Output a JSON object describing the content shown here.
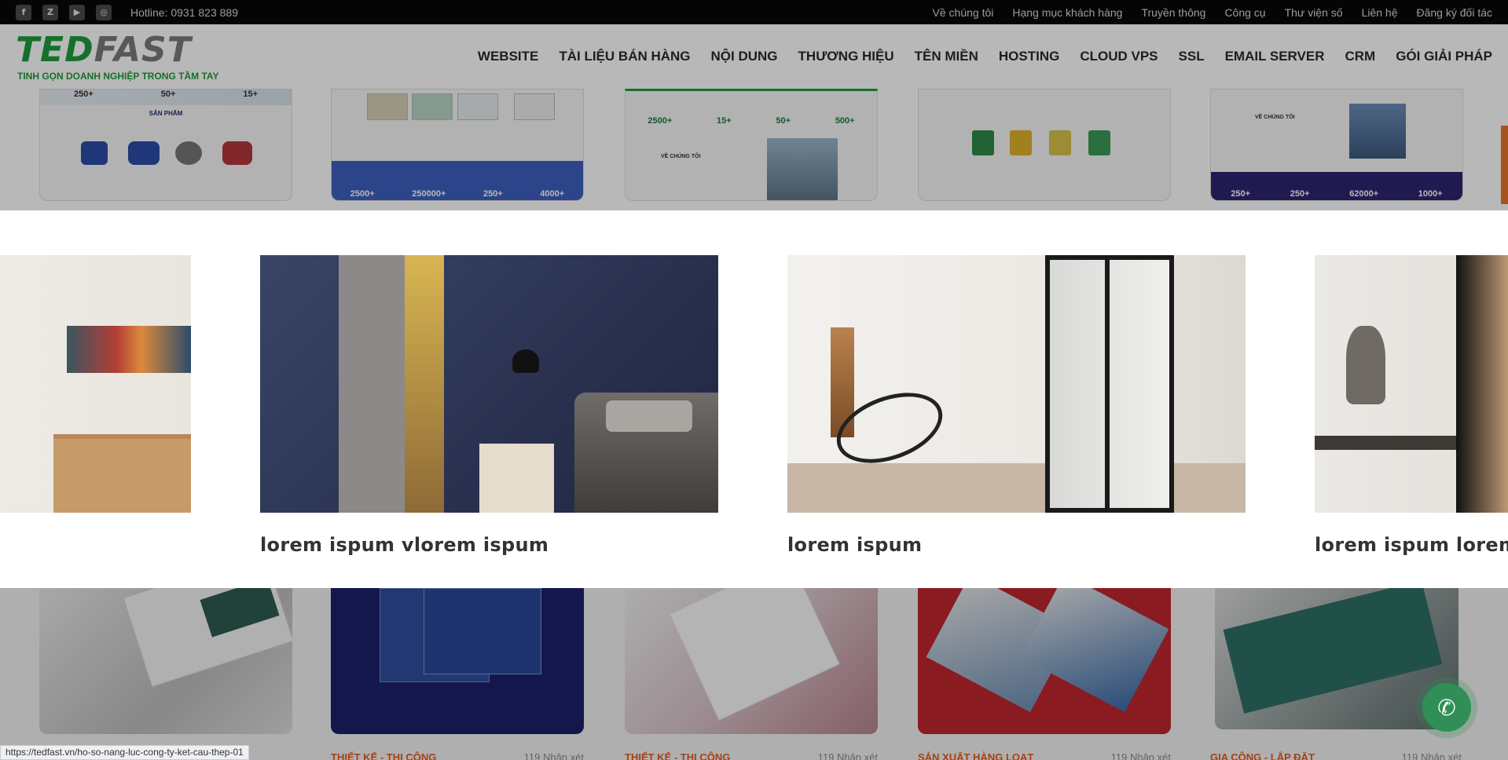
{
  "topbar": {
    "social_icons": [
      "facebook-icon",
      "zalo-icon",
      "youtube-icon",
      "instagram-icon"
    ],
    "social_glyphs": [
      "f",
      "Z",
      "▶",
      "◎"
    ],
    "hotline": "Hotline: 0931 823 889",
    "links": [
      "Về chúng tôi",
      "Hạng mục khách hàng",
      "Truyền thông",
      "Công cụ",
      "Thư viện số",
      "Liên hệ",
      "Đăng ký đối tác"
    ]
  },
  "header": {
    "logo_text_main": "TED",
    "logo_text_second": "FAST",
    "logo_slogan": "TINH GỌN DOANH NGHIỆP TRONG TẦM TAY",
    "nav": [
      "WEBSITE",
      "TÀI LIỆU BÁN HÀNG",
      "NỘI DUNG",
      "THƯƠNG HIỆU",
      "TÊN MIỀN",
      "HOSTING",
      "CLOUD VPS",
      "SSL",
      "EMAIL SERVER",
      "CRM",
      "GÓI GIẢI PHÁP"
    ]
  },
  "bg_cards": [
    {
      "stats": [
        "250+",
        "50+",
        "15+"
      ],
      "heading": "SẢN PHẨM"
    },
    {
      "stats": [
        "2500+",
        "250000+",
        "250+",
        "4000+"
      ]
    },
    {
      "stats": [
        "2500+",
        "15+",
        "50+",
        "500+"
      ],
      "heading": "VỀ CHÚNG TÔI"
    },
    {
      "stats": []
    },
    {
      "stats": [
        "250+",
        "250+",
        "62000+",
        "1000+"
      ],
      "heading": "VỀ CHÚNG TÔI"
    }
  ],
  "slider": {
    "slides": [
      {
        "caption": ""
      },
      {
        "caption": "lorem ispum vlorem ispum"
      },
      {
        "caption": "lorem ispum"
      },
      {
        "caption": "lorem ispum lorem i"
      }
    ]
  },
  "bottom_cards": [
    {
      "category": "",
      "comments": ""
    },
    {
      "category": "THIẾT KẾ - THI CÔNG",
      "comments": "119 Nhận xét"
    },
    {
      "category": "THIẾT KẾ - THI CÔNG",
      "comments": "119 Nhận xét"
    },
    {
      "category": "SẢN XUẤT HÀNG LOẠT",
      "comments": "119 Nhận xét"
    },
    {
      "category": "GIA CÔNG - LẮP ĐẶT",
      "comments": "119 Nhận xét"
    }
  ],
  "status_url": "https://tedfast.vn/ho-so-nang-luc-cong-ty-ket-cau-thep-01",
  "call_icon": "phone-icon",
  "colors": {
    "brand": "#1e9b3d",
    "category": "#e55a1c",
    "call": "#2f8f56"
  }
}
